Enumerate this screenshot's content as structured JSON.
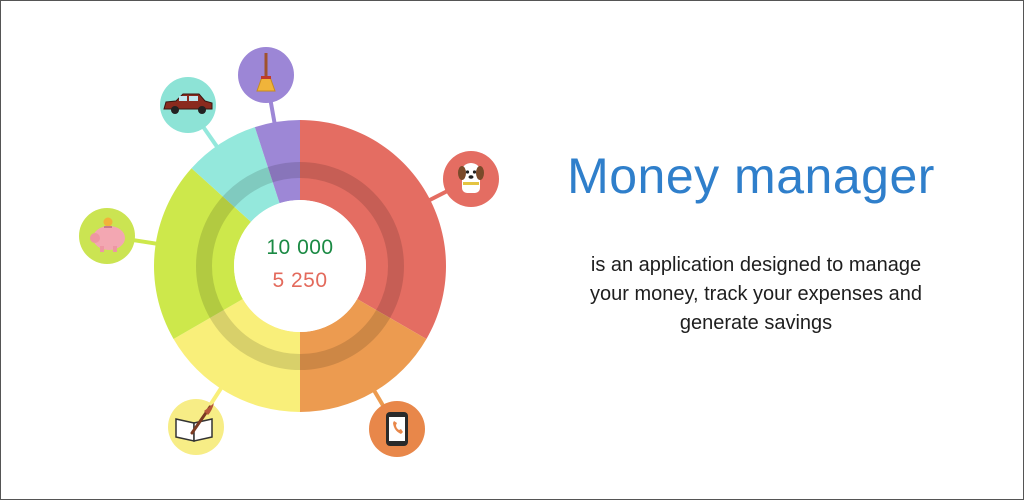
{
  "colors": {
    "background": "#ffffff",
    "title": "#2f7fcb",
    "text": "#1e1e1e",
    "income": "#1b8a44",
    "expense": "#e36a5c",
    "inner_ring": "#000000"
  },
  "chart": {
    "center": {
      "income": "10 000",
      "expense": "5 250"
    },
    "segments": [
      {
        "category": "pet",
        "share": 0.3333,
        "color": "#e46d62",
        "icon": "dog-icon",
        "icon_bg": "#e46d62"
      },
      {
        "category": "phone",
        "share": 0.1667,
        "color": "#ec9b50",
        "icon": "phone-icon",
        "icon_bg": "#e8874a"
      },
      {
        "category": "education",
        "share": 0.1667,
        "color": "#f9ef7a",
        "icon": "book-quill-icon",
        "icon_bg": "#f7ed86"
      },
      {
        "category": "savings",
        "share": 0.2,
        "color": "#cde84b",
        "icon": "piggy-bank-icon",
        "icon_bg": "#cbe452"
      },
      {
        "category": "car",
        "share": 0.0833,
        "color": "#94e8dc",
        "icon": "car-icon",
        "icon_bg": "#8de3d6"
      },
      {
        "category": "household",
        "share": 0.05,
        "color": "#9d87d6",
        "icon": "broom-icon",
        "icon_bg": "#9c86d6"
      }
    ]
  },
  "text": {
    "title": "Money manager",
    "description_lines": [
      "is an application designed to manage",
      "your money, track your expenses and",
      "generate savings"
    ]
  }
}
